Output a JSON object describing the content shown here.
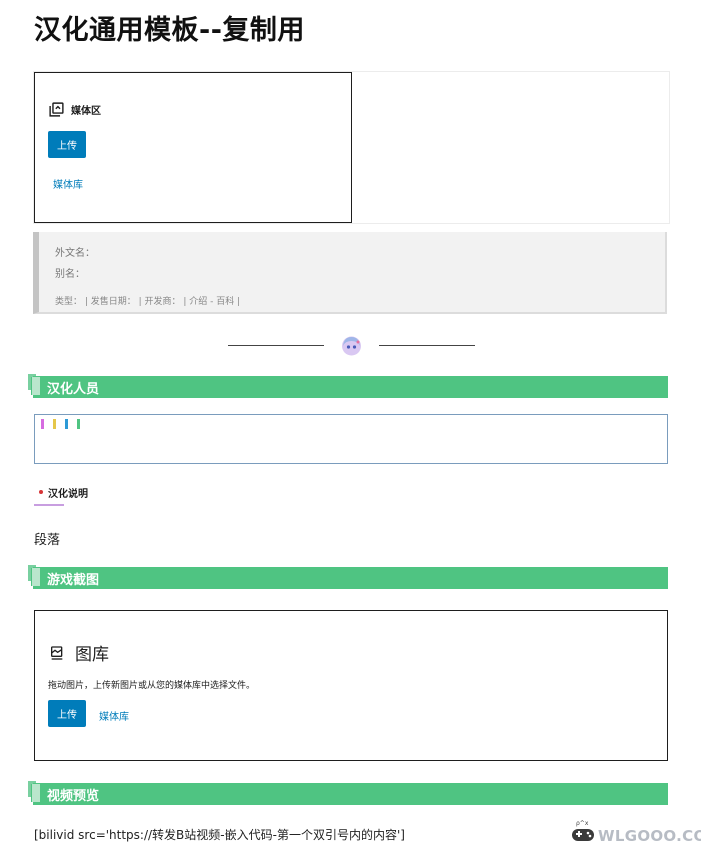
{
  "page": {
    "title": "汉化通用模板--复制用"
  },
  "media": {
    "label": "媒体区",
    "upload": "上传",
    "library": "媒体库"
  },
  "info": {
    "foreign_name": "外文名：",
    "alias": "别名：",
    "meta": "类型：  | 发售日期：  | 开发商：  | 介绍 - 百科 |"
  },
  "sections": {
    "staff": "汉化人员",
    "screenshots": "游戏截图",
    "video": "视频预览"
  },
  "staff_ticks": [
    "#d66ce0",
    "#e5c74a",
    "#2d9ad6",
    "#4fc482"
  ],
  "note": {
    "title": "汉化说明"
  },
  "paragraph": "段落",
  "gallery": {
    "title": "图库",
    "description": "拖动图片，上传新图片或从您的媒体库中选择文件。",
    "upload": "上传",
    "library": "媒体库"
  },
  "shortcode": "[bilivid src='https://转发B站视频-嵌入代码-第一个双引号内的内容']",
  "watermark": {
    "text": "WLGOOO.COM"
  },
  "colors": {
    "accent": "#007cba",
    "section_green": "#4fc482"
  }
}
